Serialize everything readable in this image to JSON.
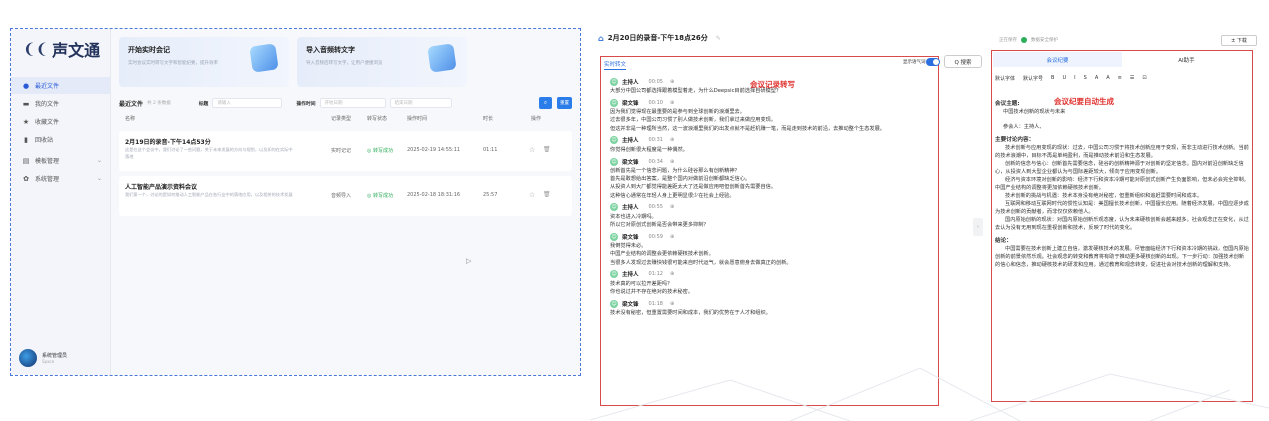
{
  "left": {
    "logo": {
      "text": "声文通"
    },
    "nav": [
      {
        "label": "最近文件",
        "icon": "●",
        "active": true
      },
      {
        "label": "我的文件",
        "icon": "▬"
      },
      {
        "label": "收藏文件",
        "icon": "★"
      },
      {
        "label": "回收站",
        "icon": "▮"
      },
      {
        "label": "模板管理",
        "icon": "▤",
        "chevron": "⌄"
      },
      {
        "label": "系统管理",
        "icon": "✿",
        "chevron": "⌄"
      }
    ],
    "user": {
      "name": "系统管理员",
      "sub": "Space"
    },
    "cards": [
      {
        "title": "开始实时会记",
        "desc": "实时会议实时转写文字和智能纪要，提升效率"
      },
      {
        "title": "导入音频转文字",
        "desc": "导入音频后转写文字，让用户便捷浏览"
      }
    ],
    "filters": {
      "recent": "最近文件",
      "count": "共 2 条数据",
      "label_title": "标题",
      "title_placeholder": "请输入",
      "label_time": "操作时间",
      "start_placeholder": "开始日期",
      "end_placeholder": "结束日期",
      "search_icon": "⌕",
      "reset": "重置"
    },
    "headers": {
      "name": "名称",
      "type": "记录类型",
      "status": "转写状态",
      "time": "操作时间",
      "duration": "时长",
      "action": "操作"
    },
    "rows": [
      {
        "title": "2月19日的录音-下午14点53分",
        "summary": "这是在这个会议中，我们讨论了一些问题，关于未来发展的方向与规划，以及如何在实际中落地",
        "type": "实时记记",
        "status": "◎ 转写成功",
        "time": "2025-02-19 14:55:11",
        "duration": "01:11"
      },
      {
        "title": "人工智能产品演示资料会议",
        "summary": "我们第一个，讨论的是如何推动人工智能产品在各行业中的落地应用，以及相关的技术发展",
        "type": "音频导入",
        "status": "◎ 转写成功",
        "time": "2025-02-18 18:31:16",
        "duration": "25:57"
      }
    ],
    "row_actions": {
      "star": "☆",
      "delete": "🗑"
    }
  },
  "middle": {
    "title": "2月20日的录音-下午18点26分",
    "edit_icon": "✎",
    "tab": "实时转文",
    "toggle_label": "显示语气词",
    "search": "Q 搜索",
    "annotation": "会议记录转写",
    "transcript": [
      {
        "speaker": "主持人",
        "time": "00:05",
        "lines": [
          "大部分中国公司都选择跟着模型着走，为什么Deepsic目前选择自研模型？"
        ]
      },
      {
        "speaker": "梁文锋",
        "time": "00:10",
        "lines": [
          "因为我们觉得现在最重要的是参与到全球创新的浪潮里去。",
          "过去很多年，中国公司习惯了别人做技术创新，我们拿过来做应用变现。",
          "但这并非是一种理所当然，这一波浪潮里我们的出发点就不是赶机赚一笔，而是走到技术的前沿，去推动整个生态发展。"
        ]
      },
      {
        "speaker": "主持人",
        "time": "00:31",
        "lines": [
          "你觉得创新很大程度是一种偶然。"
        ]
      },
      {
        "speaker": "梁文锋",
        "time": "00:34",
        "lines": [
          "创新首先是一个信念问题，为什么硅谷那么有创新精神？",
          "首先是敢想给出答案，是整个国内对做前沿创新都缺乏信心。",
          "从投资人到大厂都觉得能差距太大了还是做应用吧但创新首先需要自信。",
          "这种信心通常在年轻人身上更明显很少在社会上经验。"
        ]
      },
      {
        "speaker": "主持人",
        "time": "00:55",
        "lines": [
          "资本也进入冷期吗。",
          "所以它对原创式创新是否会带来更多抑制？"
        ]
      },
      {
        "speaker": "梁文锋",
        "time": "00:59",
        "lines": [
          "我倒觉得未必。",
          "中国产业结构的调整会更依赖硬核技术创新。",
          "当很多人发现过去赚快钱很可能来自时代运气，就会愿意俯身去做真正的创新。"
        ]
      },
      {
        "speaker": "主持人",
        "time": "01:12",
        "lines": [
          "技术真的可以拉开差距吗？",
          "你也说过并不存在绝对的技术秘密。"
        ]
      },
      {
        "speaker": "梁文锋",
        "time": "01:18",
        "lines": [
          "技术没有秘密，但重置需要时间和成本，我们的优势在于人才和组织。"
        ]
      }
    ]
  },
  "right": {
    "status_text": "正在保存",
    "security": "数据安全保护",
    "download": "± 下载",
    "tabs": [
      "会议纪要",
      "AI助手"
    ],
    "toolbar": [
      "默认字体",
      "默认字号",
      "B",
      "U",
      "I",
      "S",
      "A",
      "A",
      "≡",
      "☰",
      "⊡"
    ],
    "annotation": "会议纪要自动生成",
    "content": [
      {
        "kind": "h",
        "text": "会议主题:"
      },
      {
        "kind": "t",
        "text": "中国技术创新的现状与未来"
      },
      {
        "kind": "t",
        "text": "参会人：主持人、"
      },
      {
        "kind": "h",
        "text": "主要讨论内容："
      },
      {
        "kind": "p",
        "text": "技术创新与应用变现的现状：过去，中国公司习惯于将技术创新应用于变现，而非主动进行技术创新。当前的技术浪潮中，目标不再是单纯盈利，而是推动技术前沿和生态发展。"
      },
      {
        "kind": "p",
        "text": "创新的信念与信心：创新首先需要信念，硅谷的创新精神源于对创新的坚定信念。国内对前沿创新缺乏信心，从投资人到大型企业都认为与国际差距较大，倾向于应用变现创新。"
      },
      {
        "kind": "p",
        "text": "经济与资本环境对创新的影响：经济下行和资本冷期可能对原创式创新产生负面影响，但未必会完全抑制。中国产业结构的调整将更加依赖硬核技术创新。"
      },
      {
        "kind": "p",
        "text": "技术创新的挑战与机遇：技术本身没有绝对秘密，但重新组织和追赶需要时间和成本。"
      },
      {
        "kind": "p",
        "text": "互联网和移动互联网时代的惯性认知是：美国擅长技术创新，中国擅长应用。随着经济发展，中国应逐步成为技术创新的贡献者，而非仅仅依赖他人。"
      },
      {
        "kind": "p",
        "text": "国内原始创新的现状：对国内原始创新乐观态度，认为未来硬核创新会越来越多。社会观念正在变化，从过去认为没有无用到现在重视创新和技术，反映了时代的变化。"
      },
      {
        "kind": "h",
        "text": "结论："
      },
      {
        "kind": "p",
        "text": "中国需要在技术创新上建立自信，激发硬核技术的发展。尽管面临经济下行和资本冷期的挑战，但国内原始创新的前景依然乐观。社会观念的转变和教育将有助于推动更多硬核创新的出现。下一步行动：加强技术创新的信心和信念，推动硬核技术的研发和应用。通过教育和观念转变，促进社会对技术创新的理解和支持。"
      }
    ]
  }
}
